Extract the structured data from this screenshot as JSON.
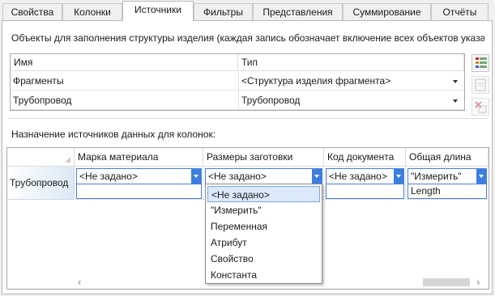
{
  "tabs": [
    {
      "label": "Свойства"
    },
    {
      "label": "Колонки"
    },
    {
      "label": "Источники"
    },
    {
      "label": "Фильтры"
    },
    {
      "label": "Представления"
    },
    {
      "label": "Суммирование"
    },
    {
      "label": "Отчёты"
    }
  ],
  "active_tab": "Источники",
  "objects_section": {
    "description": "Объекты для заполнения структуры изделия (каждая запись обозначает включение всех объектов указан",
    "columns": [
      "Имя",
      "Тип"
    ],
    "rows": [
      {
        "name": "Фрагменты",
        "type": "<Структура изделия фрагмента>"
      },
      {
        "name": "Трубопровод",
        "type": "Трубопровод"
      }
    ],
    "side_buttons": [
      "add-source-icon",
      "edit-source-icon",
      "delete-source-icon"
    ]
  },
  "mapping_section": {
    "label": "Назначение источников данных для колонок:",
    "columns": [
      "Марка материала",
      "Размеры заготовки",
      "Код документа",
      "Общая длина"
    ],
    "row_header": "Трубопровод",
    "cells": [
      "<Не задано>",
      "<Не задано>",
      "<Не задано>",
      "\"Измерить\""
    ],
    "sub_value": "Length"
  },
  "dropdown": {
    "options": [
      "<Не задано>",
      "\"Измерить\"",
      "Переменная",
      "Атрибут",
      "Свойство",
      "Константа"
    ],
    "selected": "<Не задано>"
  },
  "scrollbar": {
    "left_arrow": "‹",
    "right_arrow": "›"
  },
  "colors": {
    "accent": "#3c7fe0",
    "selection": "#dbe9fb",
    "row_header_bg": "#dbe9f6"
  }
}
